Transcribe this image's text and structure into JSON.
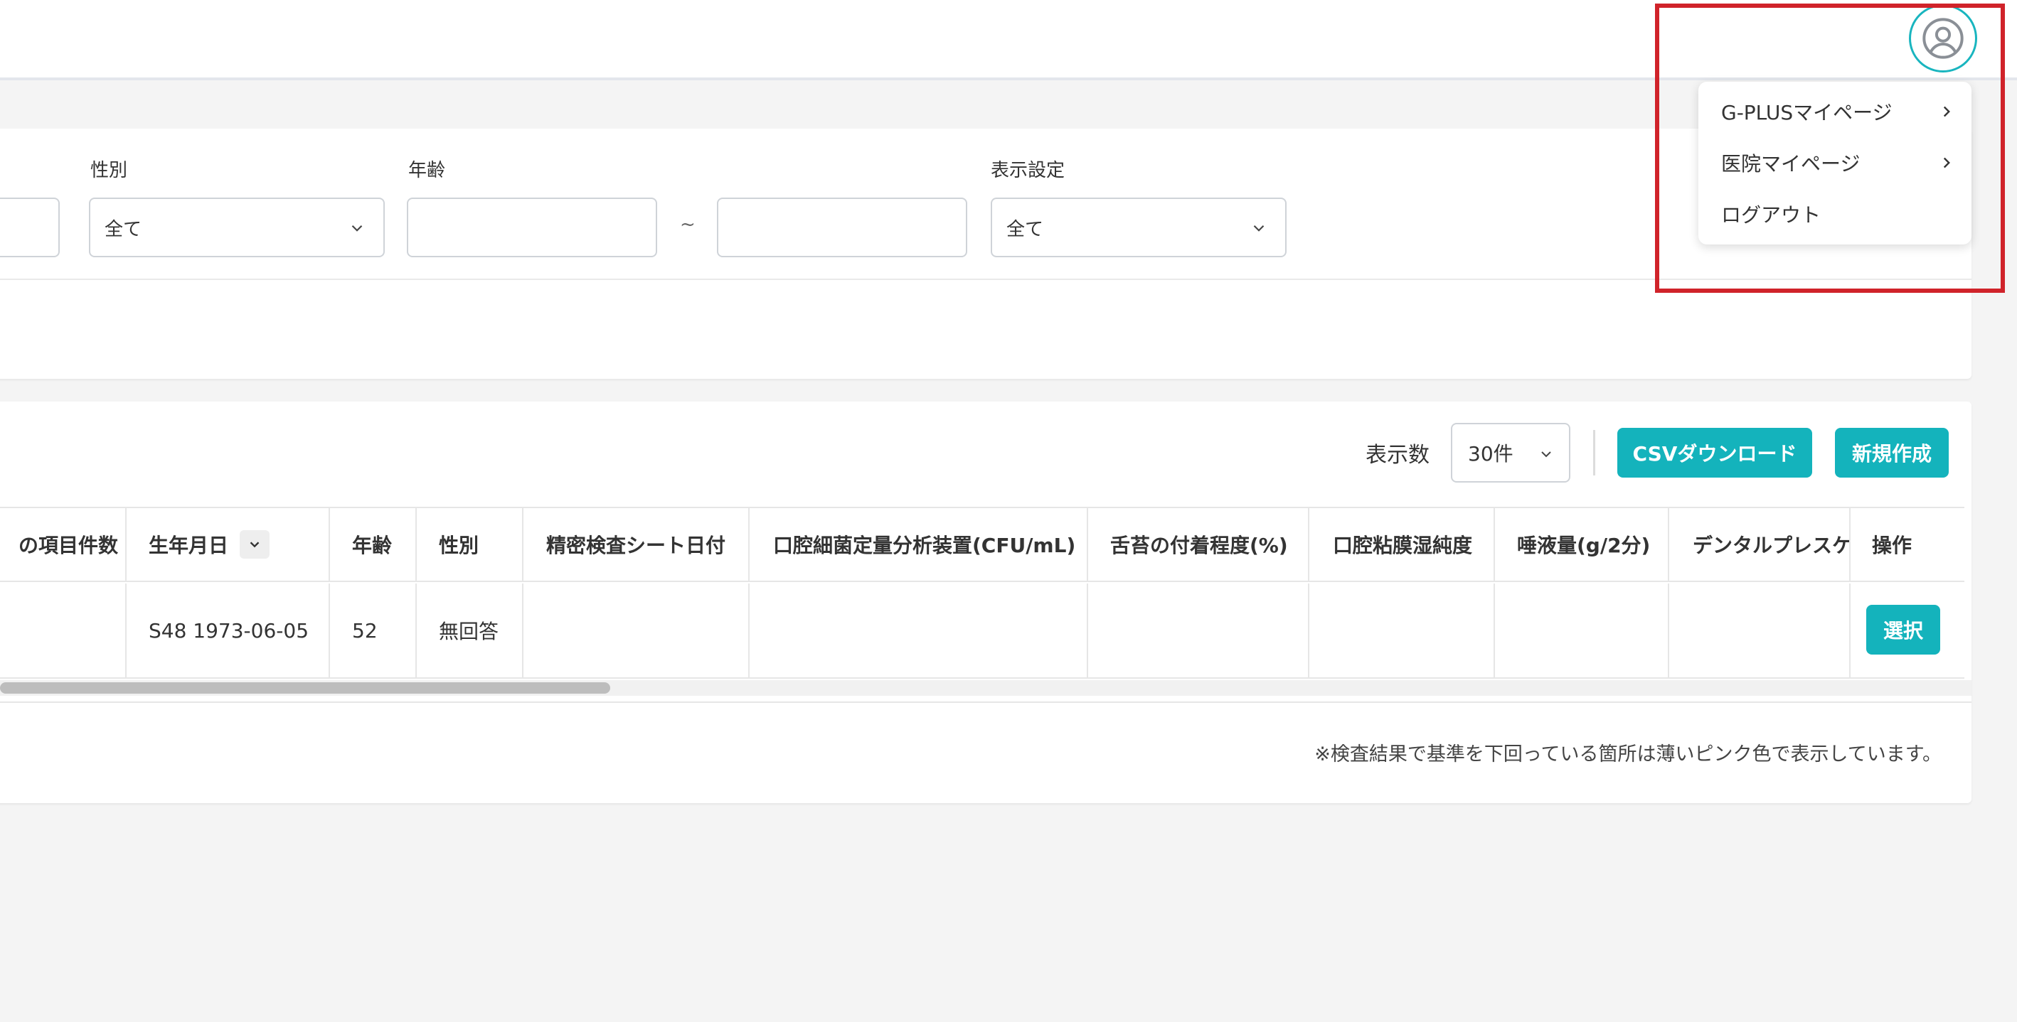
{
  "filters": {
    "gender": {
      "label": "性別",
      "value": "全て"
    },
    "age": {
      "label": "年齢",
      "from": "",
      "to": "",
      "separator": "~"
    },
    "display_setting": {
      "label": "表示設定",
      "value": "全て"
    }
  },
  "table_toolbar": {
    "count_label": "表示数",
    "count_value": "30件",
    "csv_button": "CSVダウンロード",
    "new_button": "新規作成"
  },
  "table": {
    "headers": [
      "の項目件数",
      "生年月日",
      "年齢",
      "性別",
      "精密検査シート日付",
      "口腔細菌定量分析装置(CFU/mL)",
      "舌苔の付着程度(%)",
      "口腔粘膜湿純度",
      "唾液量(g/2分)",
      "デンタルプレスケ",
      "操作"
    ],
    "rows": [
      {
        "items_count": "",
        "birthdate": "S48 1973-06-05",
        "age": "52",
        "gender": "無回答",
        "sheet_date": "",
        "bacteria": "",
        "tongue": "",
        "mucosa": "",
        "saliva": "",
        "dental": "",
        "action": "選択"
      }
    ]
  },
  "note": "※検査結果で基準を下回っている箇所は薄いピンク色で表示しています。",
  "user_menu": {
    "items": [
      {
        "label": "G-PLUSマイページ",
        "has_arrow": true
      },
      {
        "label": "医院マイページ",
        "has_arrow": true
      },
      {
        "label": "ログアウト",
        "has_arrow": false
      }
    ]
  },
  "colors": {
    "accent": "#14b3bc",
    "highlight": "#d0232a",
    "background": "#f4f4f4"
  },
  "icons": {
    "avatar": "user-circle-icon",
    "dropdown": "chevron-down-icon",
    "submenu": "chevron-right-icon"
  }
}
